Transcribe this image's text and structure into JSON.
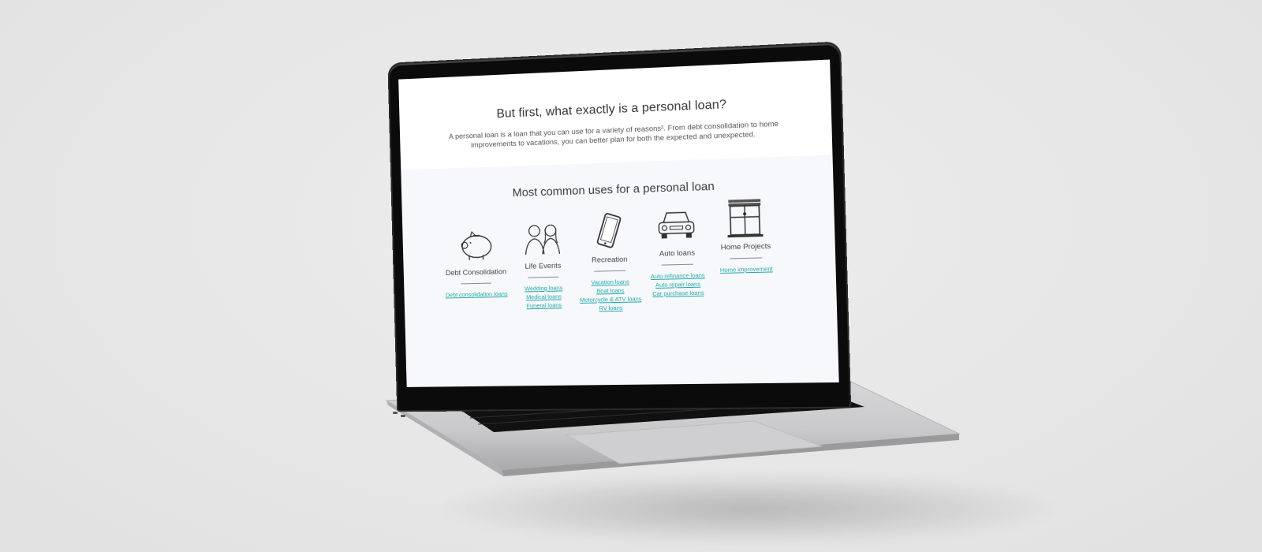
{
  "page": {
    "title": "But first, what exactly is a personal loan?",
    "intro": "A personal loan is a loan that you can use for a variety of reasons². From debt consolidation to home improvements to vacations, you can better plan for both the expected and unexpected."
  },
  "uses": {
    "title": "Most common uses for a personal loan",
    "categories": [
      {
        "name": "Debt Consolidation",
        "icon": "piggy-bank-icon",
        "links": [
          "Debt consolidation loans"
        ]
      },
      {
        "name": "Life Events",
        "icon": "couple-icon",
        "links": [
          "Wedding loans",
          "Medical loans",
          "Funeral loans"
        ]
      },
      {
        "name": "Recreation",
        "icon": "phone-icon",
        "links": [
          "Vacation loans",
          "Boat loans",
          "Motorcycle & ATV loans",
          "RV loans"
        ]
      },
      {
        "name": "Auto loans",
        "icon": "car-icon",
        "links": [
          "Auto refinance loans",
          "Auto repair loans",
          "Car purchase loans"
        ]
      },
      {
        "name": "Home Projects",
        "icon": "window-icon",
        "links": [
          "Home improvement"
        ]
      }
    ]
  },
  "colors": {
    "link": "#22a9a9",
    "section_bg": "#f6f8fb",
    "text": "#333333"
  }
}
